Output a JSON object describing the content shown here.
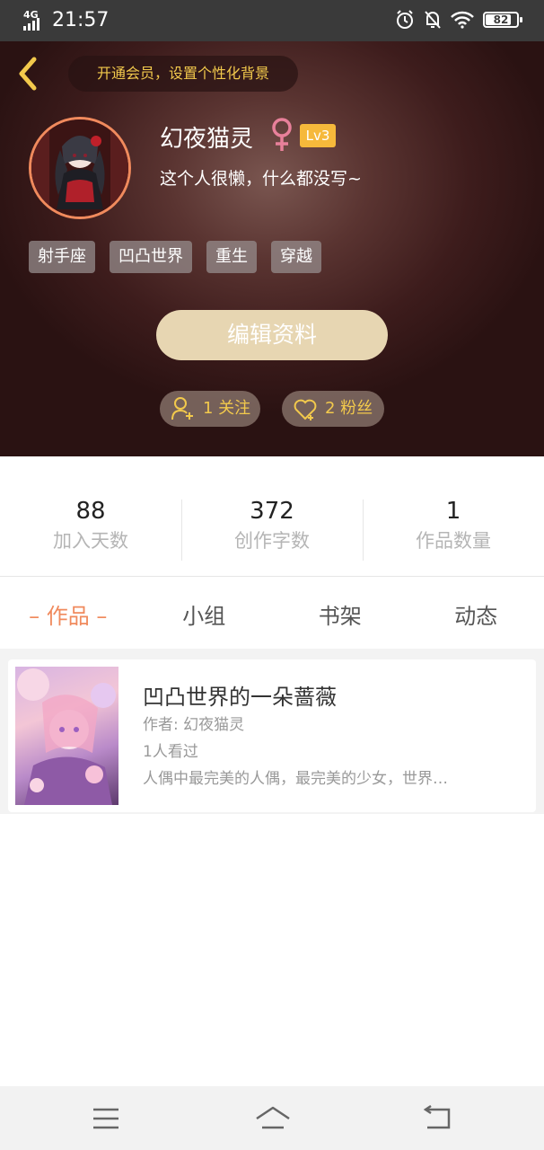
{
  "status_bar": {
    "network": "4G",
    "time": "21:57",
    "battery": "82",
    "icons": [
      "alarm-icon",
      "notifications-off-icon",
      "wifi-icon",
      "battery-icon"
    ]
  },
  "header": {
    "vip_banner": "开通会员，设置个性化背景"
  },
  "profile": {
    "username": "幻夜猫灵",
    "gender_icon": "female-icon",
    "level": "Lv3",
    "bio": "这个人很懒，什么都没写~",
    "tags": [
      "射手座",
      "凹凸世界",
      "重生",
      "穿越"
    ],
    "edit_button": "编辑资料",
    "following": "1 关注",
    "followers": "2 粉丝"
  },
  "stats": [
    {
      "value": "88",
      "label": "加入天数"
    },
    {
      "value": "372",
      "label": "创作字数"
    },
    {
      "value": "1",
      "label": "作品数量"
    }
  ],
  "tabs": [
    {
      "label": "– 作品 –",
      "active": true
    },
    {
      "label": "小组",
      "active": false
    },
    {
      "label": "书架",
      "active": false
    },
    {
      "label": "动态",
      "active": false
    }
  ],
  "works": [
    {
      "title": "凹凸世界的一朵蔷薇",
      "author": "作者: 幻夜猫灵",
      "views": "1人看过",
      "description": "人偶中最完美的人偶，最完美的少女，世界…"
    }
  ],
  "colors": {
    "accent": "#f08a5d",
    "gold": "#f2c94c",
    "edit_button": "#e7d6b2",
    "level_badge": "#f6b93b",
    "female": "#e8809a"
  }
}
